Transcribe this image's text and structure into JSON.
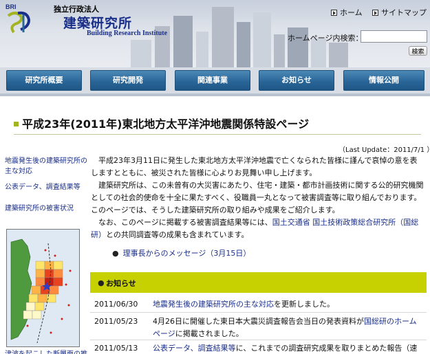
{
  "header": {
    "org_small": "独立行政法人",
    "org_name": "建築研究所",
    "org_en": "Building Research Institute",
    "logo_text": "BRI",
    "links": [
      "ホーム",
      "サイトマップ"
    ],
    "search_label": "ホームページ内検索：",
    "search_placeholder": "",
    "search_button": "検索"
  },
  "nav": [
    "研究所概要",
    "研究開発",
    "関連事業",
    "お知らせ",
    "情報公開"
  ],
  "page": {
    "title": "平成23年(2011年)東北地方太平洋沖地震関係特設ページ",
    "last_update": "（Last Update：2011/7/1 ）"
  },
  "sidebar": {
    "links": [
      "地震発生後の建築研究所の主な対応",
      "公表データ、調査結果等",
      "建築研究所の被害状況"
    ],
    "bottom_text": "津波を起こした断層面の推"
  },
  "intro": {
    "p1": "平成23年3月11日に発生した東北地方太平洋沖地震で亡くなられた皆様に謹んで哀悼の意を表しますとともに、被災された皆様に心よりお見舞い申し上げます。",
    "p2": "建築研究所は、この未曾有の大災害にあたり、住宅・建築・都市計画技術に関する公的研究機関としての社会的使命を十全に果たすべく、役職員一丸となって被害調査等に取り組んでおります。このページでは、そうした建築研究所の取り組みや成果をご紹介します。",
    "p3_before": "なお、このページに掲載する被害調査結果等には、",
    "p3_link": "国土交通省 国土技術政策総合研究所（国総研）",
    "p3_after": "との共同調査等の成果も含まれています。"
  },
  "message_link": "理事長からのメッセージ（3月15日）",
  "news": {
    "title": "お知らせ",
    "items": [
      {
        "date": "2011/06/30",
        "link": "地震発生後の建築研究所の主な対応",
        "text": "を更新しました。"
      },
      {
        "date": "2011/05/23",
        "text": "4月26日に開催した東日本大震災調査報告会当日の発表資料が",
        "link": "国総研のホームページ",
        "text2": "に掲載されました。"
      },
      {
        "date": "2011/05/13",
        "link": "公表データ、調査結果等",
        "text": "に、これまでの調査研究成果を取りまとめた報告（速"
      }
    ]
  },
  "colors": {
    "nav_blue": "#2a6698",
    "news_bar": "#c7d000",
    "link": "#1a2f8a",
    "title_mark": "#a4b320"
  }
}
